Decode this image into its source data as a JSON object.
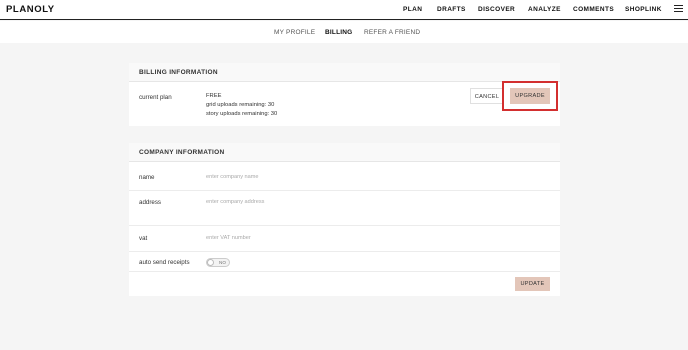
{
  "header": {
    "logo": "PLANOLY",
    "nav": [
      "PLAN",
      "DRAFTS",
      "DISCOVER",
      "ANALYZE",
      "COMMENTS",
      "SHOPLINK"
    ]
  },
  "subnav": {
    "items": [
      "MY PROFILE",
      "BILLING",
      "REFER A FRIEND"
    ],
    "active": "BILLING"
  },
  "billing": {
    "title": "BILLING INFORMATION",
    "current_plan_label": "current plan",
    "plan_name": "FREE",
    "grid_uploads": "grid uploads remaining: 30",
    "story_uploads": "story uploads remaining: 30",
    "cancel_label": "CANCEL",
    "upgrade_label": "UPGRADE"
  },
  "company": {
    "title": "COMPANY INFORMATION",
    "name_label": "name",
    "name_placeholder": "enter company name",
    "address_label": "address",
    "address_placeholder": "enter company address",
    "vat_label": "vat",
    "vat_placeholder": "enter VAT number",
    "auto_send_label": "auto send receipts",
    "toggle_text": "NO",
    "update_label": "UPDATE"
  },
  "colors": {
    "accent": "#e3c6b9",
    "highlight": "#d32f2f"
  }
}
